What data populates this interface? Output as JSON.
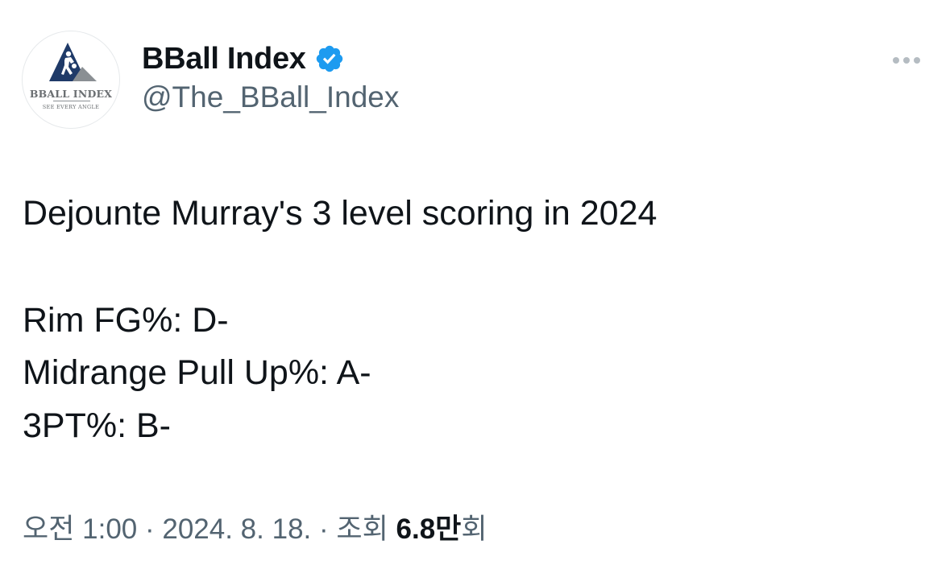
{
  "account": {
    "display_name": "BBall Index",
    "handle": "@The_BBall_Index",
    "verified": true,
    "avatar": {
      "logo_title": "BBALL INDEX",
      "logo_tagline": "SEE EVERY ANGLE"
    }
  },
  "menu": {
    "icon": "more-horizontal-icon"
  },
  "tweet": {
    "lines": [
      "Dejounte Murray's 3 level scoring in 2024",
      "Rim FG%: D-",
      "Midrange Pull Up%: A-",
      "3PT%: B-"
    ]
  },
  "meta": {
    "time": "오전 1:00",
    "separator": "·",
    "date": "2024. 8. 18.",
    "views_label": "조회",
    "views_count": "6.8만",
    "views_suffix": "회"
  },
  "colors": {
    "text_primary": "#0f1419",
    "text_secondary": "#536471",
    "verified_blue": "#1d9bf0",
    "logo_navy": "#1f3a68",
    "logo_grey": "#8a8f93"
  }
}
